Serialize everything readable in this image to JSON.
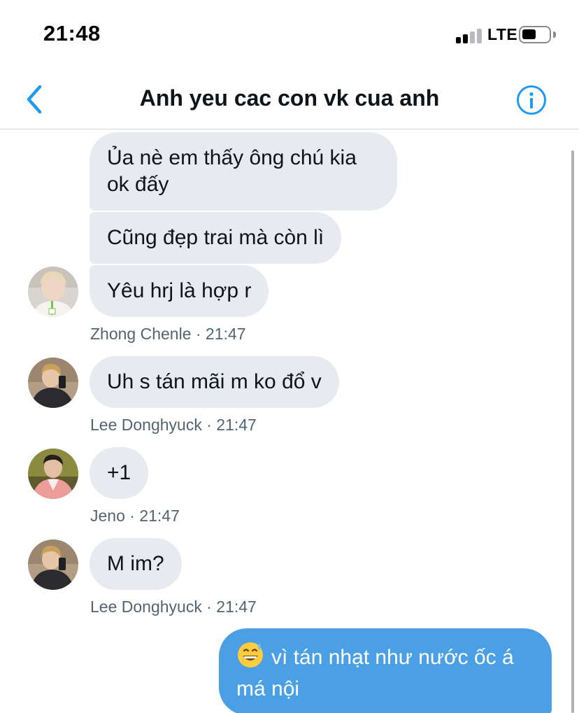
{
  "status_bar": {
    "time": "21:48",
    "network": "LTE",
    "signal_bars_active": 2,
    "signal_bars_total": 4
  },
  "header": {
    "title": "Anh yeu cac con vk cua anh",
    "back_icon": "chevron-left-icon",
    "info_icon": "info-icon"
  },
  "messages": [
    {
      "id": "m1",
      "direction": "in",
      "text": "Ủa nè em thấy ông chú kia ok đấy"
    },
    {
      "id": "m2",
      "direction": "in",
      "text": "Cũng đẹp trai mà còn lì"
    },
    {
      "id": "m3",
      "direction": "in",
      "text": "Yêu hrj là hợp r"
    },
    {
      "id": "m4",
      "direction": "in",
      "text": "Uh s tán mãi m ko đổ v"
    },
    {
      "id": "m5",
      "direction": "in",
      "text": "+1"
    },
    {
      "id": "m6",
      "direction": "in",
      "text": "M im?"
    },
    {
      "id": "m7",
      "direction": "out",
      "emoji": "😅",
      "text": "vì tán nhạt như nước ốc á má nội"
    }
  ],
  "meta": [
    {
      "sender": "Zhong Chenle",
      "time": "21:47",
      "label": "Zhong Chenle · 21:47"
    },
    {
      "sender": "Lee Donghyuck",
      "time": "21:47",
      "label": "Lee Donghyuck · 21:47"
    },
    {
      "sender": "Jeno",
      "time": "21:47",
      "label": "Jeno · 21:47"
    },
    {
      "sender": "Lee Donghyuck",
      "time": "21:47",
      "label": "Lee Donghyuck · 21:47"
    }
  ],
  "colors": {
    "accent": "#1d9bf0",
    "incoming_bubble": "#e7ebf0",
    "outgoing_bubble": "#4a9fe5",
    "meta_text": "#536471"
  }
}
